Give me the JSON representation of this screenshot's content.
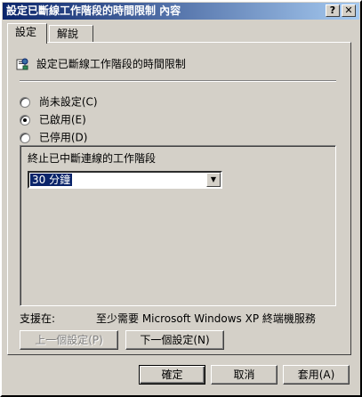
{
  "window": {
    "title": "設定已斷線工作階段的時間限制 內容",
    "help_button": "?",
    "close_button": "✕"
  },
  "tabs": [
    {
      "label": "設定"
    },
    {
      "label": "解說"
    }
  ],
  "policy": {
    "name": "設定已斷線工作階段的時間限制"
  },
  "radios": {
    "not_configured": "尚未設定(C)",
    "enabled": "已啟用(E)",
    "disabled": "已停用(D)",
    "selected": "enabled"
  },
  "options": {
    "label": "終止已中斷連線的工作階段",
    "value": "30 分鐘"
  },
  "supported": {
    "label": "支援在:",
    "value": "至少需要 Microsoft Windows XP 終端機服務"
  },
  "buttons": {
    "previous": "上一個設定(P)",
    "next": "下一個設定(N)",
    "ok": "確定",
    "cancel": "取消",
    "apply": "套用(A)"
  },
  "colors": {
    "titlebar_start": "#0a246a",
    "titlebar_end": "#a6caf0",
    "face": "#d4d0c8",
    "selection": "#0a246a"
  }
}
